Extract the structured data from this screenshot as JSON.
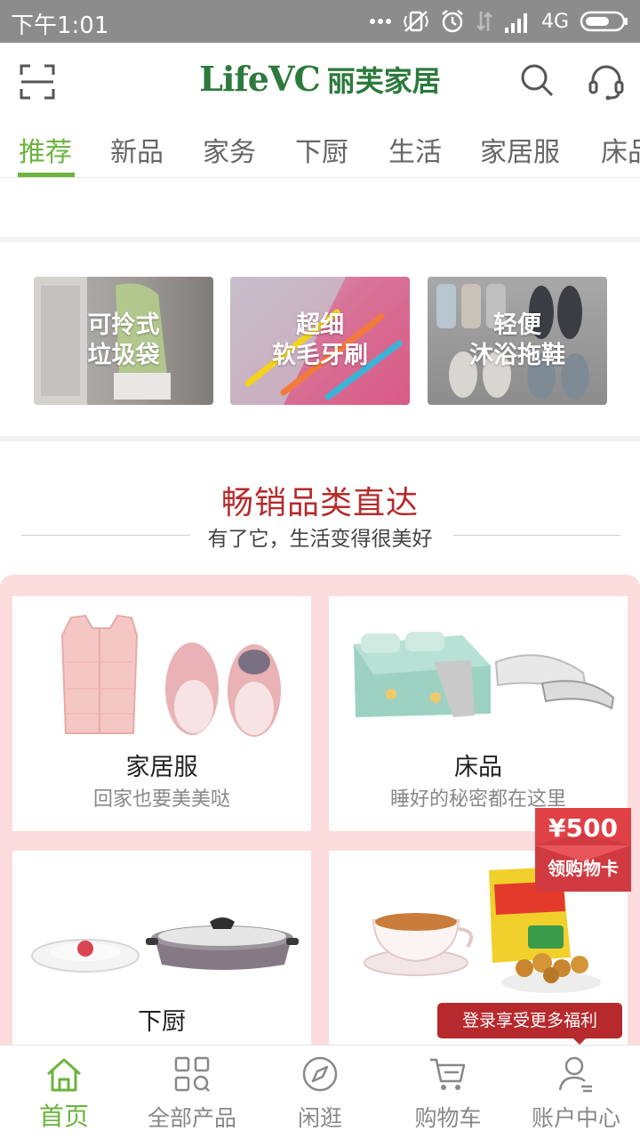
{
  "status_bar": {
    "time": "下午1:01",
    "network": "4G",
    "icons": [
      "more-dots-icon",
      "vibrate-off-icon",
      "alarm-icon",
      "data-transfer-icon",
      "signal-icon",
      "battery-icon"
    ]
  },
  "header": {
    "logo_en": "LifeVC",
    "logo_cn": "丽芙家居",
    "icons": [
      "scan-icon",
      "search-icon",
      "headset-icon"
    ]
  },
  "tabs": [
    {
      "label": "推荐",
      "active": true
    },
    {
      "label": "新品"
    },
    {
      "label": "家务"
    },
    {
      "label": "下厨"
    },
    {
      "label": "生活"
    },
    {
      "label": "家居服"
    },
    {
      "label": "床品"
    }
  ],
  "promos": [
    {
      "line1": "可拎式",
      "line2": "垃圾袋"
    },
    {
      "line1": "超细",
      "line2": "软毛牙刷"
    },
    {
      "line1": "轻便",
      "line2": "沐浴拖鞋"
    }
  ],
  "section": {
    "title": "畅销品类直达",
    "subtitle": "有了它，生活变得很美好"
  },
  "categories": [
    {
      "name": "家居服",
      "desc": "回家也要美美哒"
    },
    {
      "name": "床品",
      "desc": "睡好的秘密都在这里"
    },
    {
      "name": "下厨",
      "desc": ""
    },
    {
      "name": "",
      "desc": ""
    }
  ],
  "coupon": {
    "amount": "¥500",
    "label": "领购物卡"
  },
  "login_tip": "登录享受更多福利",
  "bottom_nav": [
    {
      "label": "首页",
      "icon": "home-icon",
      "active": true
    },
    {
      "label": "全部产品",
      "icon": "grid-icon"
    },
    {
      "label": "闲逛",
      "icon": "compass-icon"
    },
    {
      "label": "购物车",
      "icon": "cart-icon"
    },
    {
      "label": "账户中心",
      "icon": "user-icon"
    }
  ],
  "colors": {
    "brand_green": "#6cb33f",
    "logo_green": "#2c7a3c",
    "section_red": "#b52b2b",
    "panel_pink": "#fcdcdc",
    "coupon_red": "#e04146",
    "tip_red": "#b6292c"
  }
}
